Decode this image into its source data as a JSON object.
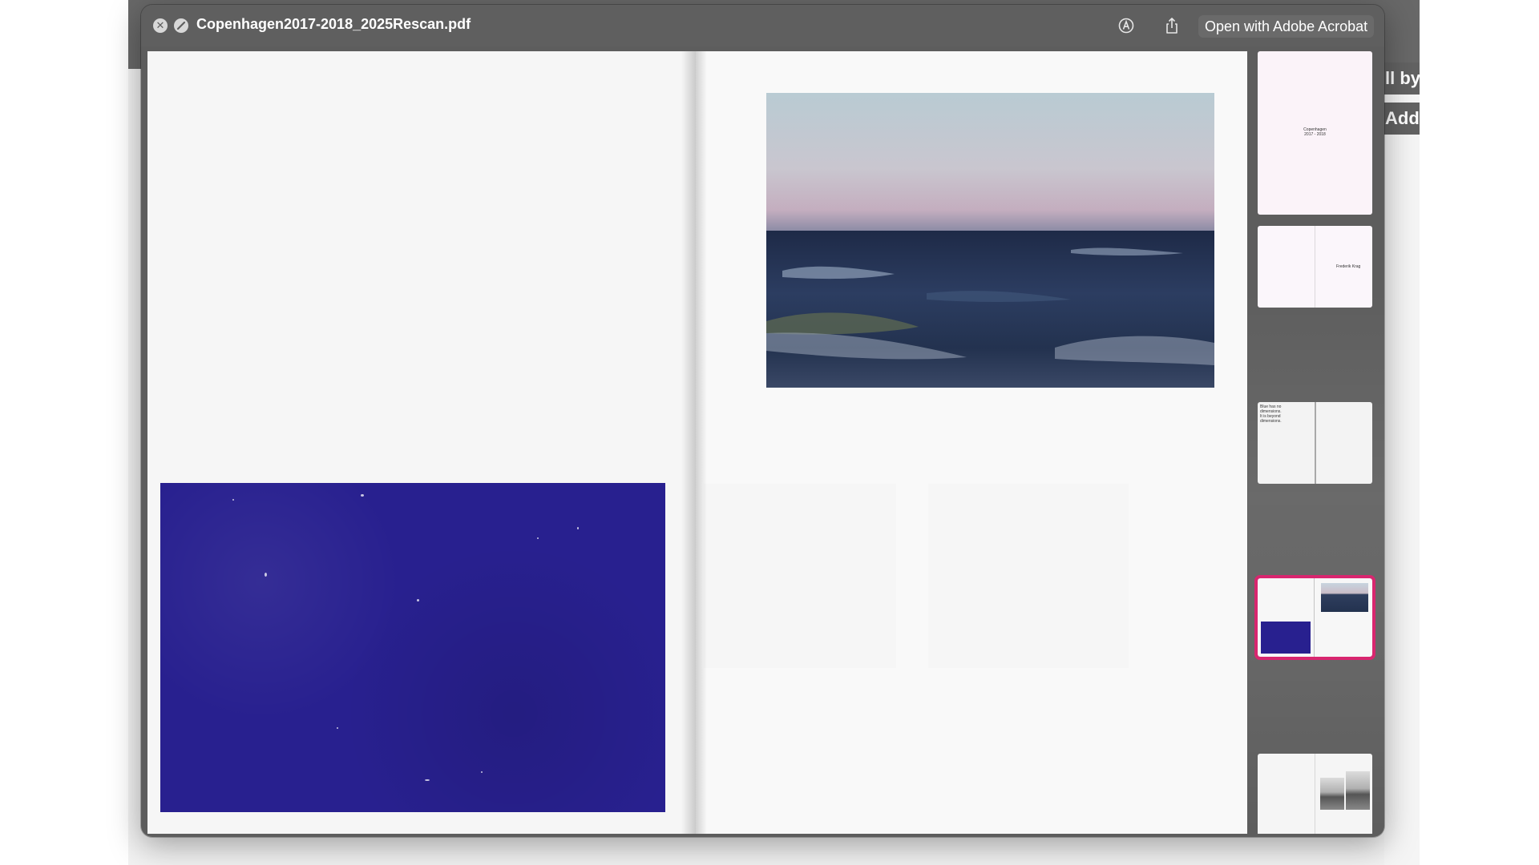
{
  "window": {
    "title": "Copenhagen2017-2018_2025Rescan.pdf",
    "open_with_label": "Open with Adobe Acrobat",
    "close_icon": "close-icon",
    "minimize_icon": "minimize-icon",
    "markup_icon": "markup-icon",
    "share_icon": "share-icon"
  },
  "background_app": {
    "fragment_1": "ll by",
    "fragment_2": "Add"
  },
  "thumbnails": {
    "selected_index": 4,
    "items": [
      {
        "title_line_1": "Copenhagen",
        "title_line_2": "2017 - 2018"
      },
      {
        "label": "Frederik Krag"
      },
      {
        "text_lines": [
          "Blue has no",
          "dimensions.",
          "It is beyond",
          "dimensions."
        ]
      },
      {},
      {}
    ]
  },
  "colors": {
    "window_bg": "#5d5d5d",
    "selection_accent": "#d8266f",
    "blue_block": "#28208f"
  }
}
